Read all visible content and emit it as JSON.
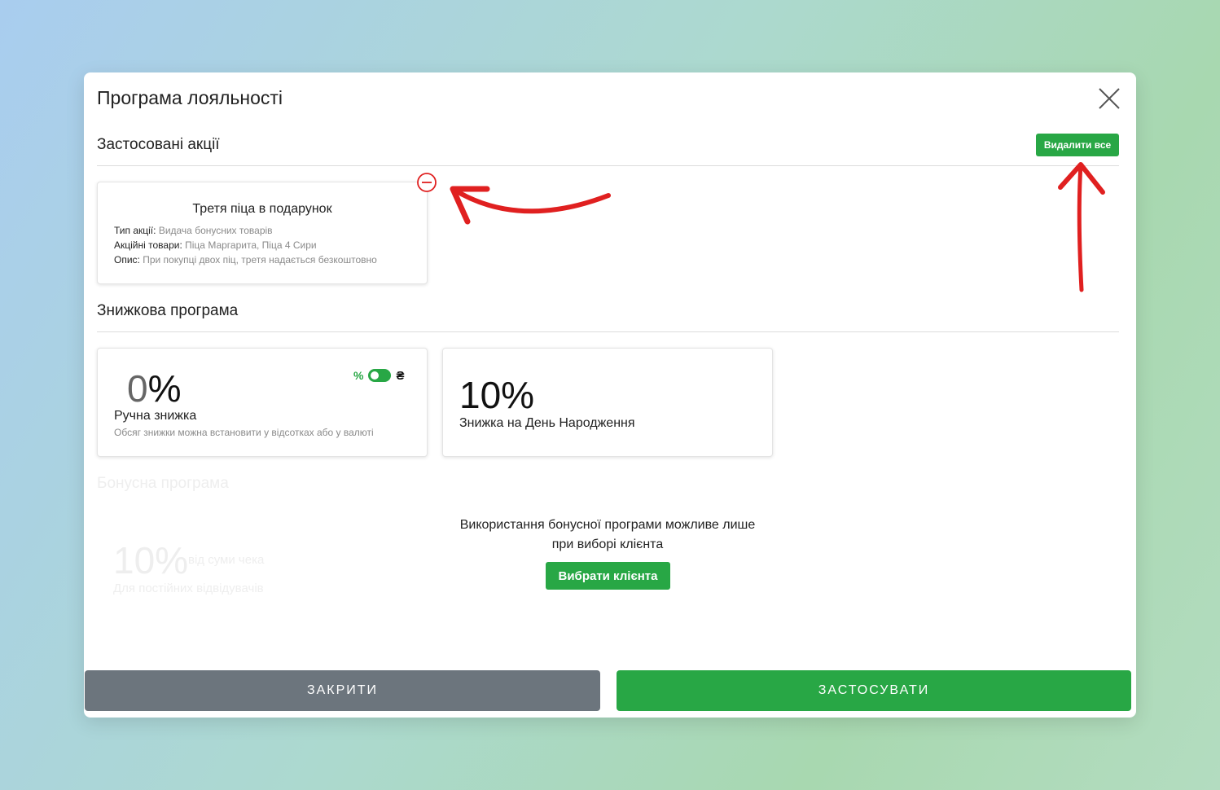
{
  "modal": {
    "title": "Програма лояльності"
  },
  "applied_promotions": {
    "section_title": "Застосовані акції",
    "delete_all_label": "Видалити все",
    "promo": {
      "title": "Третя піца в подарунок",
      "type_label": "Тип акції:",
      "type_value": "Видача бонусних товарів",
      "items_label": "Акційні товари:",
      "items_value": "Піца Маргарита, Піца 4 Сири",
      "desc_label": "Опис:",
      "desc_value": "При покупці двох піц, третя надається безкоштовно"
    }
  },
  "discount_program": {
    "section_title": "Знижкова програма",
    "manual": {
      "value_number": "0",
      "value_suffix": "%",
      "name": "Ручна знижка",
      "hint": "Обсяг знижки можна встановити у відсотках або у валюті",
      "toggle_percent": "%",
      "toggle_currency": "₴"
    },
    "birthday": {
      "value": "10%",
      "name": "Знижка на День Народження"
    }
  },
  "bonus_program": {
    "section_title": "Бонусна програма",
    "value": "10%",
    "of_check": "від суми чека",
    "subtitle": "Для постійних відвідувачів",
    "message_line1": "Використання бонусної програми можливе лише",
    "message_line2": "при виборі клієнта",
    "select_client_label": "Вибрати клієнта"
  },
  "footer": {
    "close_label": "ЗАКРИТИ",
    "apply_label": "ЗАСТОСУВАТИ"
  },
  "colors": {
    "accent_green": "#28a745",
    "secondary_gray": "#6c757d",
    "annotation_red": "#e02020"
  },
  "icons": {
    "close": "close-icon",
    "remove": "minus-circle-icon"
  }
}
